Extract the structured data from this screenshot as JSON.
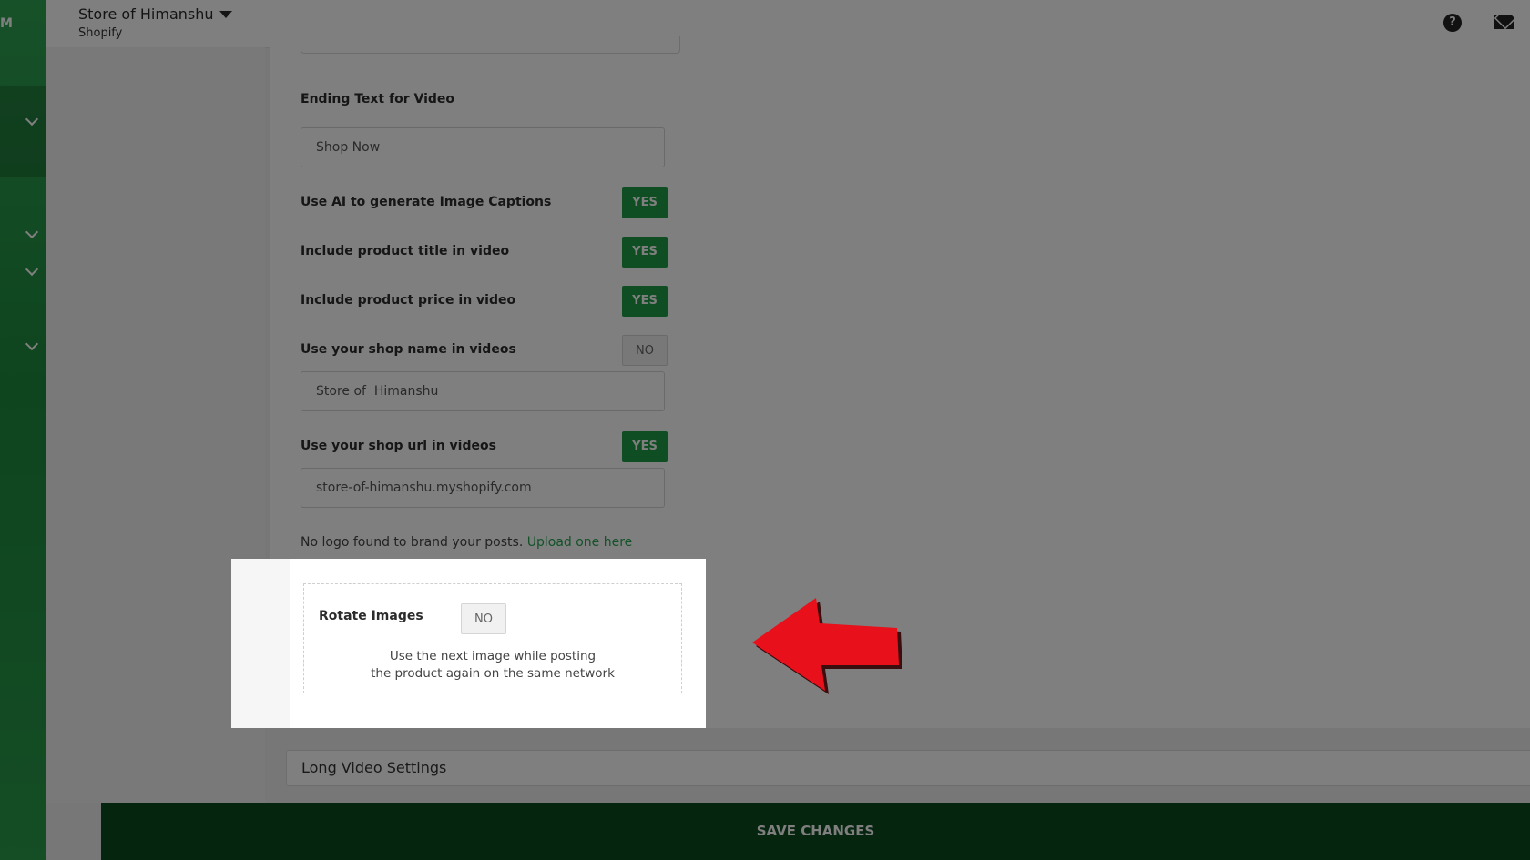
{
  "header": {
    "store_name": "Store of Himanshu",
    "platform": "Shopify"
  },
  "form": {
    "ending_text_label": "Ending Text for Video",
    "ending_text_value": "Shop Now",
    "ai_captions_label": "Use AI to generate Image Captions",
    "ai_captions_toggle": "YES",
    "product_title_label": "Include product title in video",
    "product_title_toggle": "YES",
    "product_price_label": "Include product price in video",
    "product_price_toggle": "YES",
    "shop_name_label": "Use your shop name in videos",
    "shop_name_toggle": "NO",
    "shop_name_value": "Store of  Himanshu",
    "shop_url_label": "Use your shop url in videos",
    "shop_url_toggle": "YES",
    "shop_url_value": "store-of-himanshu.myshopify.com",
    "no_logo_text": "No logo found to brand your posts.",
    "upload_link": "Upload one here"
  },
  "rotate": {
    "label": "Rotate Images",
    "toggle": "NO",
    "desc_line1": "Use the next image while posting",
    "desc_line2": "the product again on the same network"
  },
  "long_video": {
    "label": "Long Video Settings"
  },
  "save": {
    "label": "SAVE CHANGES"
  },
  "icons": {
    "help": "help-icon",
    "mail": "mail-icon",
    "dropdown": "caret-down-icon",
    "arrow": "red-arrow-icon"
  },
  "colors": {
    "accent": "#1e9c47",
    "save_bar": "#0d4a1f",
    "arrow": "#e8101a"
  }
}
